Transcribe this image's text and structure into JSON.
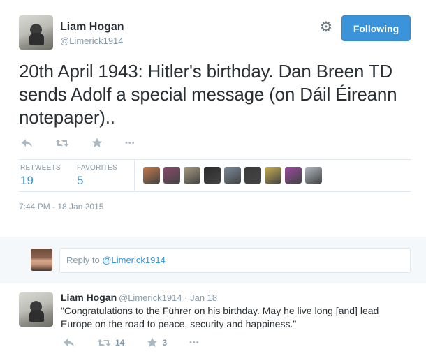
{
  "tweet": {
    "author_name": "Liam Hogan",
    "author_handle": "@Limerick1914",
    "follow_label": "Following",
    "text": "20th April 1943: Hitler's birthday. Dan Breen TD sends Adolf a special message (on Dáil Éireann notepaper)..",
    "actions": {
      "more_label": "•••"
    },
    "stats": {
      "retweets_label": "RETWEETS",
      "retweets_count": "19",
      "favorites_label": "FAVORITES",
      "favorites_count": "5"
    },
    "timestamp": "7:44 PM - 18 Jan 2015"
  },
  "favoriter_avatar_colors": [
    "#c47a4a",
    "#8a4a6a",
    "#a89a80",
    "#2a2a2a",
    "#7a8a9a",
    "#3a3a3a",
    "#c9b050",
    "#9a4aa0",
    "#b0b8c0"
  ],
  "reply_composer": {
    "prefix": "Reply to ",
    "mention": "@Limerick1914"
  },
  "reply_tweet": {
    "author_name": "Liam Hogan",
    "author_handle": "@Limerick1914",
    "separator": "·",
    "date": "Jan 18",
    "text": "\"Congratulations to the Führer on his birthday. May he live long [and] lead Europe on the road to peace, security and happiness.\"",
    "retweet_count": "14",
    "favorite_count": "3",
    "more_label": "•••"
  },
  "colors": {
    "accent": "#3b94d9",
    "muted": "#8899a6",
    "text": "#292f33"
  },
  "icons": [
    "gear-icon",
    "reply-icon",
    "retweet-icon",
    "favorite-icon",
    "more-icon"
  ]
}
